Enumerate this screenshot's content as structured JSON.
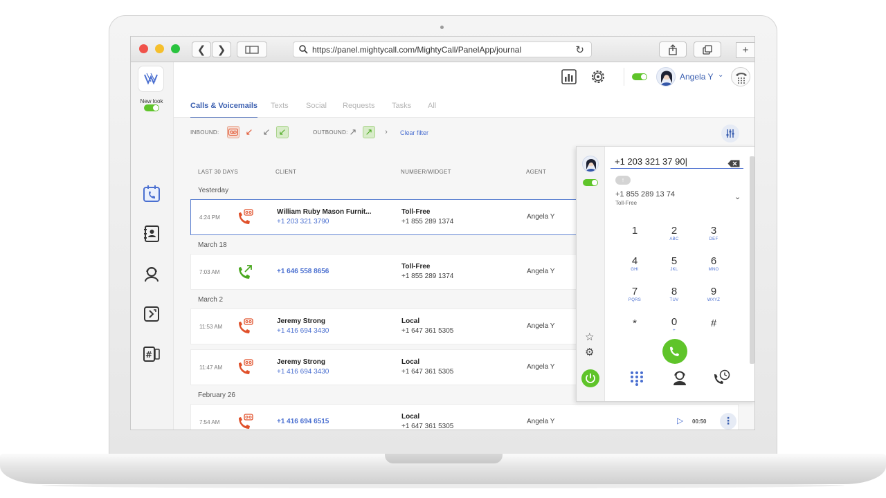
{
  "browser": {
    "url": "https://panel.mightycall.com/MightyCall/PanelApp/journal"
  },
  "sidebar": {
    "new_look_label": "New look"
  },
  "header": {
    "user_name": "Angela Y"
  },
  "tabs": [
    {
      "label": "Calls & Voicemails",
      "active": true
    },
    {
      "label": "Texts"
    },
    {
      "label": "Social"
    },
    {
      "label": "Requests"
    },
    {
      "label": "Tasks"
    },
    {
      "label": "All"
    }
  ],
  "filters": {
    "inbound_label": "INBOUND:",
    "outbound_label": "OUTBOUND:",
    "clear_label": "Clear filter"
  },
  "columns": {
    "period": "LAST 30 DAYS",
    "client": "CLIENT",
    "number": "NUMBER/WIDGET",
    "agent": "AGENT"
  },
  "groups": [
    "Yesterday",
    "March 18",
    "March 2",
    "February 26"
  ],
  "calls": [
    {
      "time": "4:24 PM",
      "kind": "voicemail",
      "name": "William Ruby Mason Furnit...",
      "phone": "+1 203 321 3790",
      "type": "Toll-Free",
      "number": "+1 855 289 1374",
      "agent": "Angela Y"
    },
    {
      "time": "7:03 AM",
      "kind": "outbound",
      "name": "",
      "phone": "+1 646 558 8656",
      "type": "Toll-Free",
      "number": "+1 855 289 1374",
      "agent": "Angela Y"
    },
    {
      "time": "11:53 AM",
      "kind": "voicemail",
      "name": "Jeremy Strong",
      "phone": "+1 416 694 3430",
      "type": "Local",
      "number": "+1 647 361 5305",
      "agent": "Angela Y"
    },
    {
      "time": "11:47 AM",
      "kind": "voicemail",
      "name": "Jeremy Strong",
      "phone": "+1 416 694 3430",
      "type": "Local",
      "number": "+1 647 361 5305",
      "agent": "Angela Y"
    },
    {
      "time": "7:54 AM",
      "kind": "voicemail",
      "name": "",
      "phone": "+1 416 694 6515",
      "type": "Local",
      "number": "+1 647 361 5305",
      "agent": "Angela Y",
      "duration": "00:50"
    }
  ],
  "dialer": {
    "input": "+1 203 321 37 90",
    "from_number": "+1 855 289 13 74",
    "from_type": "Toll-Free",
    "keys": [
      {
        "digit": "1",
        "letters": ""
      },
      {
        "digit": "2",
        "letters": "ABC"
      },
      {
        "digit": "3",
        "letters": "DEF"
      },
      {
        "digit": "4",
        "letters": "GHI"
      },
      {
        "digit": "5",
        "letters": "JKL"
      },
      {
        "digit": "6",
        "letters": "MNO"
      },
      {
        "digit": "7",
        "letters": "PQRS"
      },
      {
        "digit": "8",
        "letters": "TUV"
      },
      {
        "digit": "9",
        "letters": "WXYZ"
      },
      {
        "digit": "*",
        "letters": ""
      },
      {
        "digit": "0",
        "letters": "+"
      },
      {
        "digit": "#",
        "letters": ""
      }
    ]
  },
  "colors": {
    "accent": "#4a6fd0",
    "green": "#5fc42a",
    "voicemail": "#e0502a"
  }
}
